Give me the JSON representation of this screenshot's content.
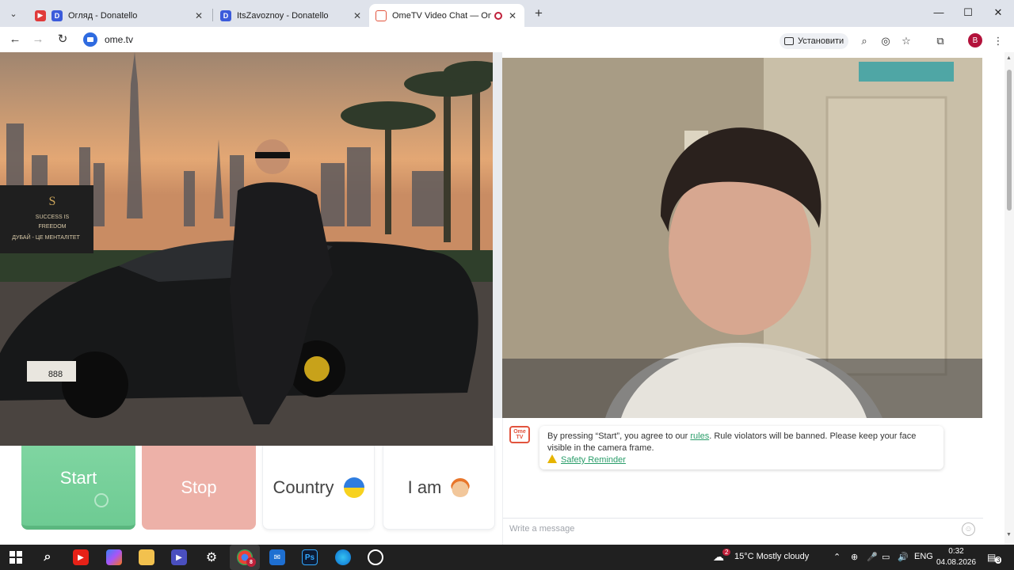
{
  "browser": {
    "tabs": [
      {
        "title": "Огляд - Donatello",
        "favicon": "donatello-icon",
        "active": false
      },
      {
        "title": "ItsZavoznoy - Donatello",
        "favicon": "donatello-icon",
        "active": false
      },
      {
        "title": "OmeTV Video Chat — Ome",
        "favicon": "ometv-icon",
        "active": true
      }
    ],
    "url": "ome.tv",
    "install_label": "Установити",
    "profile_initial": "B"
  },
  "video_left": {
    "sign_line1": "SUCCESS IS",
    "sign_line2": "FREEDOM",
    "sign_line3": "ДУБАЙ - ЦЕ МЕНТАЛІТЕТ",
    "plate": "888"
  },
  "controls": {
    "start_label": "Start",
    "stop_label": "Stop",
    "country_label": "Country",
    "iam_label": "I am"
  },
  "chat": {
    "notice_before": "By pressing “Start”, you agree to our ",
    "notice_link": "rules",
    "notice_after": ". Rule violators will be banned. Please keep your face visible in the camera frame.",
    "safety_link": "Safety Reminder",
    "input_placeholder": "Write a message",
    "logo_text": "Ome TV"
  },
  "taskbar": {
    "weather_badge": "2",
    "weather": "15°C  Mostly cloudy",
    "lang": "ENG",
    "time": "0:32",
    "date": "04.08.2026",
    "notif_count": "3",
    "chrome_badge": "8"
  },
  "colors": {
    "start_green": "#7fd5a1",
    "stop_red": "#edb1a8",
    "link_green": "#2a9d6a",
    "taskbar": "#202020"
  }
}
